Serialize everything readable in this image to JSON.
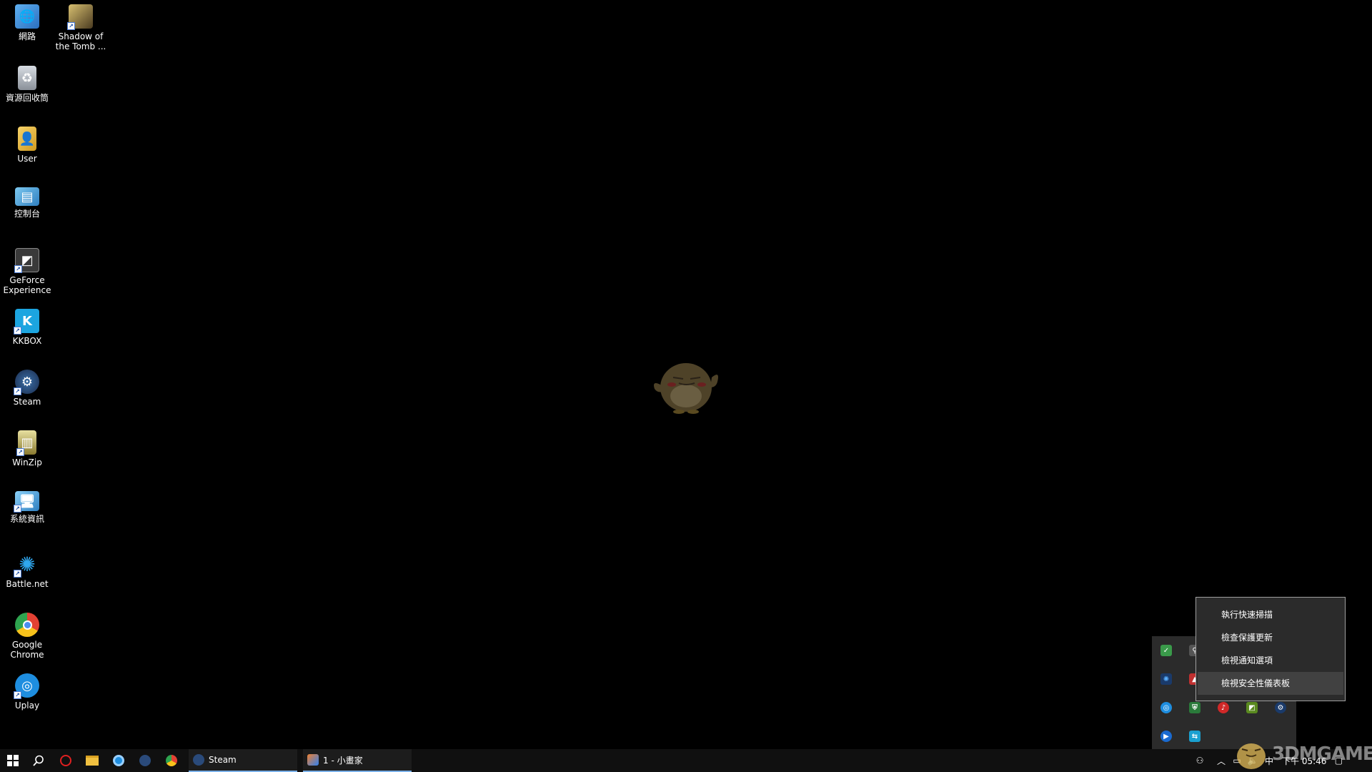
{
  "desktop": {
    "icons": [
      {
        "label": "網路"
      },
      {
        "label": "Shadow of\nthe Tomb ..."
      },
      {
        "label": "資源回收筒"
      },
      {
        "label": "User"
      },
      {
        "label": "控制台"
      },
      {
        "label": "GeForce\nExperience"
      },
      {
        "label": "KKBOX"
      },
      {
        "label": "Steam"
      },
      {
        "label": "WinZip"
      },
      {
        "label": "系統資訊"
      },
      {
        "label": "Battle.net"
      },
      {
        "label": "Google\nChrome"
      },
      {
        "label": "Uplay"
      }
    ]
  },
  "context_menu": {
    "items": [
      {
        "label": "執行快速掃描"
      },
      {
        "label": "檢查保護更新"
      },
      {
        "label": "檢視通知選項"
      },
      {
        "label": "檢視安全性儀表板"
      }
    ],
    "hovered_index": 3
  },
  "taskbar": {
    "apps": [
      {
        "label": "Steam"
      },
      {
        "label": "1 - 小畫家"
      }
    ],
    "tray": {
      "ime": "中",
      "clock": "下午 05:46"
    }
  },
  "watermark": {
    "text": "3DMGAME"
  },
  "colors": {
    "desktop_bg": "#000000",
    "taskbar_bg": "#101010",
    "menu_bg": "#2b2b2b",
    "menu_hover": "#414141",
    "accent": "#7ab0e8"
  }
}
